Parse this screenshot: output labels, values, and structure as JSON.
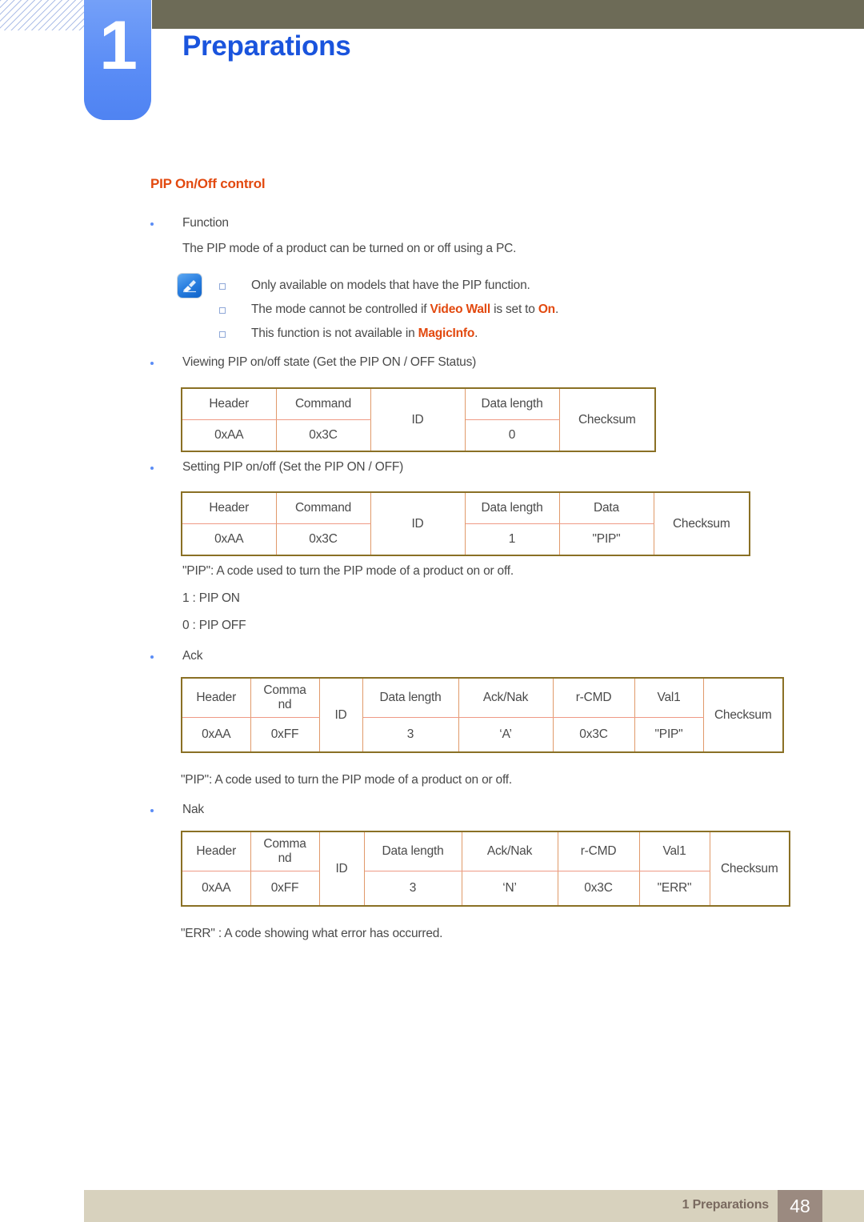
{
  "header": {
    "chapter_number": "1",
    "chapter_title": "Preparations",
    "accent_blue": "#5b8df6",
    "olive": "#6d6b57",
    "title_blue": "#1a54dd"
  },
  "section": {
    "heading": "PIP On/Off control",
    "heading_color": "#e2490f"
  },
  "function": {
    "bullet_label": "Function",
    "description": "The PIP mode of a product can be turned on or off using a PC."
  },
  "note": {
    "icon": "note-pen-icon",
    "items": [
      {
        "prefix": "Only available on models that have the PIP function.",
        "highlight1": "",
        "middle": "",
        "highlight2": "",
        "suffix": ""
      },
      {
        "prefix": "The mode cannot be controlled if ",
        "highlight1": "Video Wall",
        "middle": " is set to ",
        "highlight2": "On",
        "suffix": "."
      },
      {
        "prefix": "This function is not available in ",
        "highlight1": "MagicInfo",
        "middle": "",
        "highlight2": "",
        "suffix": "."
      }
    ]
  },
  "sections": {
    "viewing_label": "Viewing PIP on/off state (Get the PIP ON / OFF Status)",
    "setting_label": "Setting PIP on/off (Set the PIP ON / OFF)",
    "ack_label": "Ack",
    "nak_label": "Nak"
  },
  "notes_text": {
    "pip_code_1": "\"PIP\": A code used to turn the PIP mode of a product on or off.",
    "pip_on": "1 : PIP ON",
    "pip_off": "0 : PIP OFF",
    "pip_code_2": "\"PIP\": A code used to turn the PIP mode of a product on or off.",
    "err_code": "\"ERR\" : A code showing what error has occurred."
  },
  "tables": {
    "get_status": {
      "headers": [
        "Header",
        "Command",
        "ID",
        "Data length",
        "Checksum"
      ],
      "values": [
        "0xAA",
        "0x3C",
        "",
        "0",
        ""
      ],
      "merged": [
        "ID",
        "Checksum"
      ]
    },
    "set_status": {
      "headers": [
        "Header",
        "Command",
        "ID",
        "Data length",
        "Data",
        "Checksum"
      ],
      "values": [
        "0xAA",
        "0x3C",
        "",
        "1",
        "\"PIP\"",
        ""
      ],
      "merged": [
        "ID",
        "Checksum"
      ]
    },
    "ack": {
      "headers": [
        "Header",
        "Comma nd",
        "ID",
        "Data length",
        "Ack/Nak",
        "r-CMD",
        "Val1",
        "Checksum"
      ],
      "header_command_line1": "Comma",
      "header_command_line2": "nd",
      "values": [
        "0xAA",
        "0xFF",
        "",
        "3",
        "‘A’",
        "0x3C",
        "\"PIP\"",
        ""
      ],
      "merged": [
        "ID",
        "Checksum"
      ]
    },
    "nak": {
      "headers": [
        "Header",
        "Comma nd",
        "ID",
        "Data length",
        "Ack/Nak",
        "r-CMD",
        "Val1",
        "Checksum"
      ],
      "header_command_line1": "Comma",
      "header_command_line2": "nd",
      "values": [
        "0xAA",
        "0xFF",
        "",
        "3",
        "‘N’",
        "0x3C",
        "\"ERR\"",
        ""
      ],
      "merged": [
        "ID",
        "Checksum"
      ]
    }
  },
  "footer": {
    "label": "1 Preparations",
    "page_number": "48",
    "bar_color": "#d8d2be",
    "page_box_color": "#9b8a80"
  }
}
